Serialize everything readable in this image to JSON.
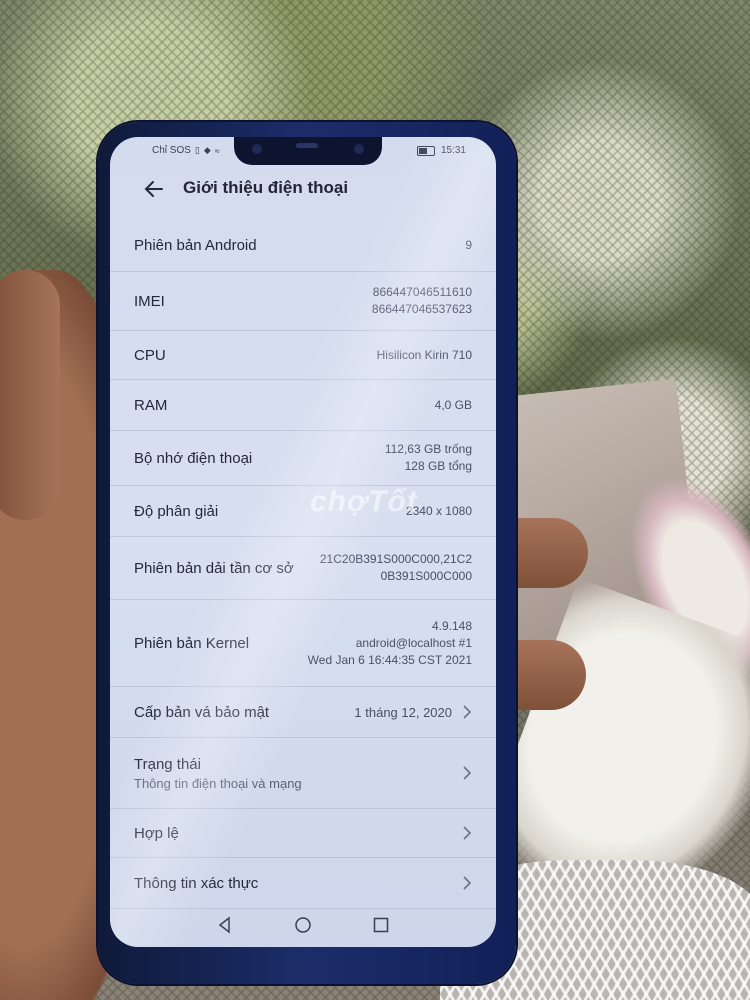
{
  "status_bar": {
    "left_text": "Chỉ SOS",
    "time": "15:31"
  },
  "header": {
    "title": "Giới thiệu điện thoại",
    "back_icon": "arrow-left-icon"
  },
  "rows": [
    {
      "label": "Phiên bản Android",
      "value": "9"
    },
    {
      "label": "IMEI",
      "value_lines": [
        "866447046511610",
        "866447046537623"
      ]
    },
    {
      "label": "CPU",
      "value": "Hisilicon Kirin 710"
    },
    {
      "label": "RAM",
      "value": "4,0 GB"
    },
    {
      "label": "Bộ nhớ điện thoại",
      "value_lines": [
        "112,63  GB trống",
        "128  GB tổng"
      ]
    },
    {
      "label": "Độ phân giải",
      "value": "2340 x 1080"
    },
    {
      "label": "Phiên bản dải tần cơ sở",
      "value_lines": [
        "21C20B391S000C000,21C2",
        "0B391S000C000"
      ]
    },
    {
      "label": "Phiên bản Kernel",
      "value_lines": [
        "4.9.148",
        "android@localhost #1",
        "Wed Jan 6 16:44:35 CST 2021"
      ]
    },
    {
      "label": "Cấp bản vá bảo mật",
      "value": "1 tháng 12, 2020"
    },
    {
      "label": "Trạng thái",
      "sublabel": "Thông tin điện thoại và mạng"
    },
    {
      "label": "Hợp lệ"
    },
    {
      "label": "Thông tin xác thực"
    }
  ],
  "watermark": "chợTốt",
  "nav_icons": [
    "back-triangle-icon",
    "home-circle-icon",
    "recents-square-icon"
  ]
}
